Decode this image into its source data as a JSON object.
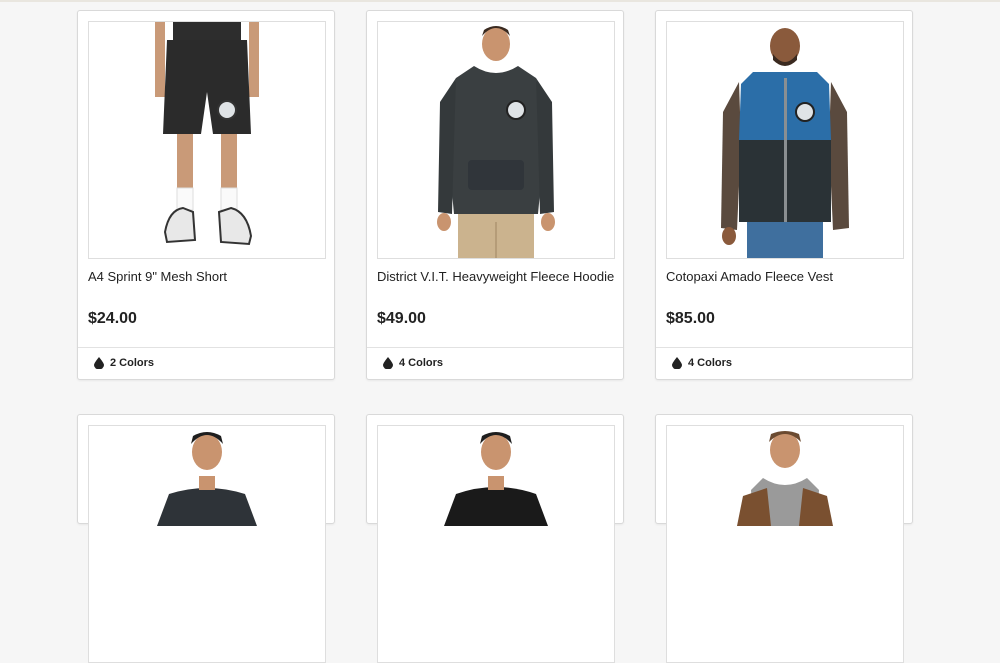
{
  "products": [
    {
      "title": "A4 Sprint 9\" Mesh Short",
      "price": "$24.00",
      "colors": "2 Colors"
    },
    {
      "title": "District V.I.T. Heavyweight Fleece Hoodie",
      "price": "$49.00",
      "colors": "4 Colors"
    },
    {
      "title": "Cotopaxi Amado Fleece Vest",
      "price": "$85.00",
      "colors": "4 Colors"
    }
  ],
  "palette": {
    "card_border": "#d9d9d9",
    "shorts": "#2b2b2b",
    "hoodie": "#3a3f41",
    "vest_blue": "#2b6ea8",
    "vest_dark": "#2a3236",
    "sleeve_brown": "#5a4a3e",
    "jeans": "#3f6f9e",
    "khaki": "#cbb38e"
  }
}
